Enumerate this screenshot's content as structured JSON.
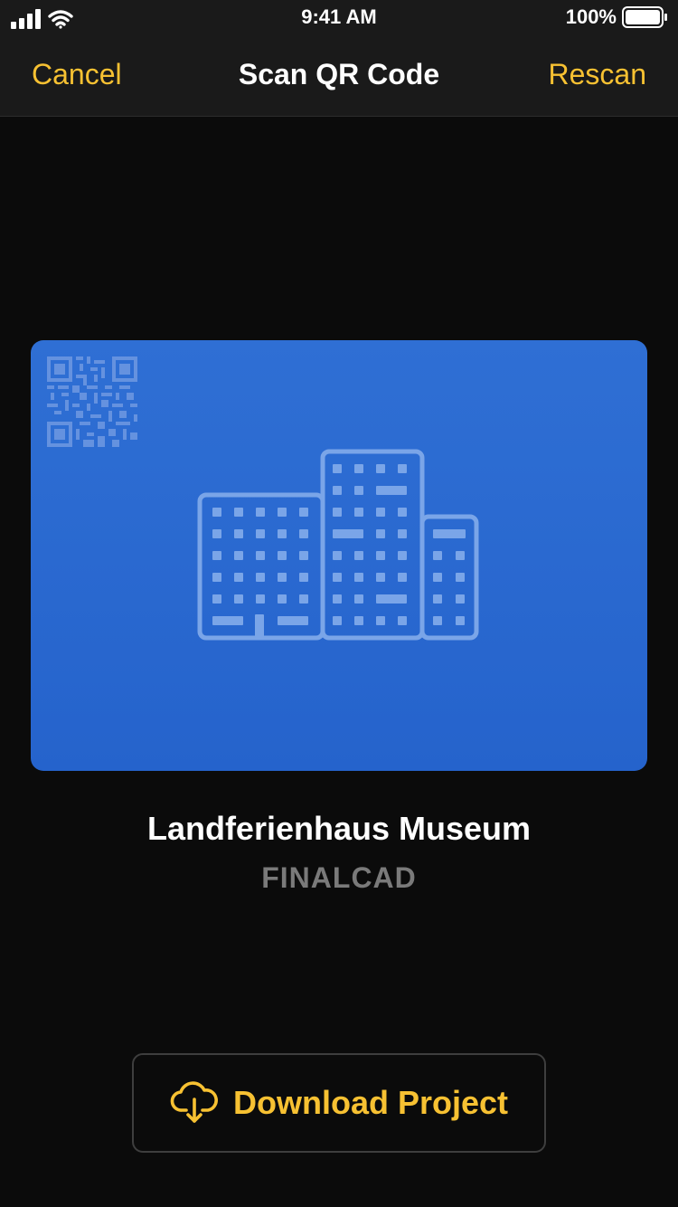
{
  "status_bar": {
    "time": "9:41 AM",
    "battery": "100%",
    "icons": [
      "signal-icon",
      "wifi-icon",
      "battery-icon"
    ]
  },
  "nav": {
    "cancel_label": "Cancel",
    "title": "Scan QR Code",
    "rescan_label": "Rescan"
  },
  "card": {
    "icons": [
      "qr-code-icon",
      "building-icon"
    ],
    "background_color": "#2563cc"
  },
  "project": {
    "name": "Landferienhaus Museum",
    "company": "FINALCAD"
  },
  "download_button": {
    "label": "Download Project",
    "icon": "cloud-download-icon"
  },
  "colors": {
    "accent": "#f7c132",
    "background": "#0b0b0b",
    "card_blue": "#2563cc"
  }
}
